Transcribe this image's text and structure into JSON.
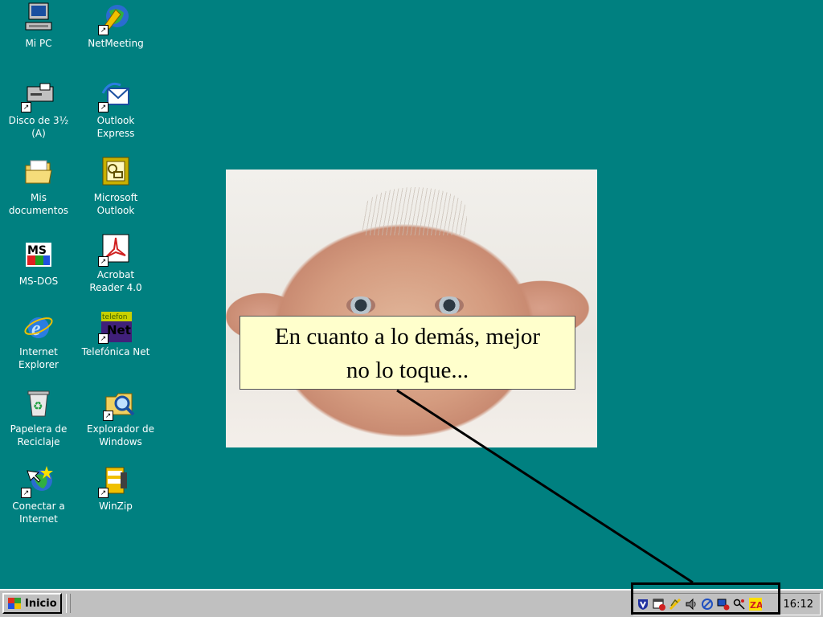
{
  "desktop_icons": [
    {
      "id": "mi-pc",
      "label": "Mi PC",
      "icon": "computer-icon"
    },
    {
      "id": "netmeeting",
      "label": "NetMeeting",
      "icon": "netmeeting-icon"
    },
    {
      "id": "disco",
      "label": "Disco de 3½\n(A)",
      "icon": "floppy-drive-icon"
    },
    {
      "id": "outlook-express",
      "label": "Outlook\nExpress",
      "icon": "outlook-express-icon"
    },
    {
      "id": "mis-documentos",
      "label": "Mis\ndocumentos",
      "icon": "folder-icon"
    },
    {
      "id": "microsoft-outlook",
      "label": "Microsoft\nOutlook",
      "icon": "outlook-icon"
    },
    {
      "id": "ms-dos",
      "label": "MS-DOS",
      "icon": "ms-dos-icon"
    },
    {
      "id": "acrobat",
      "label": "Acrobat\nReader 4.0",
      "icon": "acrobat-icon"
    },
    {
      "id": "internet-explorer",
      "label": "Internet\nExplorer",
      "icon": "internet-explorer-icon"
    },
    {
      "id": "telefonica-net",
      "label": "Telefónica Net",
      "icon": "telefonica-net-icon",
      "glyph_text": "Net",
      "glyph_top": "telefon"
    },
    {
      "id": "papelera",
      "label": "Papelera de\nReciclaje",
      "icon": "recycle-bin-icon"
    },
    {
      "id": "explorador",
      "label": "Explorador de\nWindows",
      "icon": "windows-explorer-icon"
    },
    {
      "id": "conectar",
      "label": "Conectar a\nInternet",
      "icon": "connect-internet-icon"
    },
    {
      "id": "winzip",
      "label": "WinZip",
      "icon": "winzip-icon"
    }
  ],
  "ms_dos_glyph": "MS",
  "callout": {
    "text_line1": "En cuanto a lo demás, mejor",
    "text_line2": "no lo toque..."
  },
  "taskbar": {
    "start_label": "Inicio",
    "clock": "16:12",
    "tray_icons": [
      "antivirus-shield-icon",
      "scheduler-icon",
      "power-plug-icon",
      "speaker-icon",
      "network-icon",
      "display-icon",
      "key-icon",
      "zonealarm-icon"
    ],
    "zonealarm_glyph": "ZA"
  },
  "colors": {
    "desktop": "#008080",
    "taskbar": "#c0c0c0",
    "callout_bg": "#ffffcc"
  }
}
